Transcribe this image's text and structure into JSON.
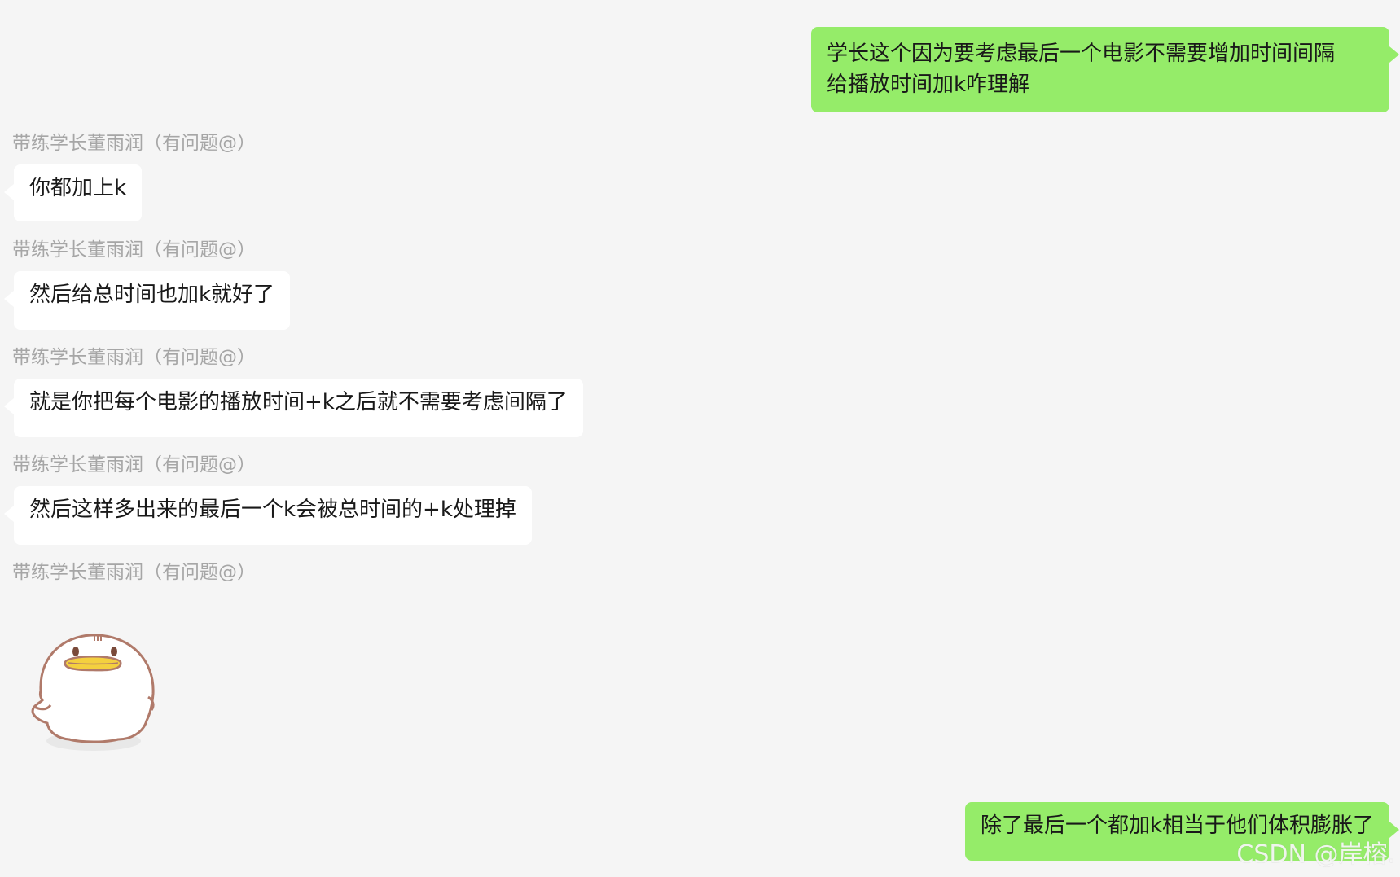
{
  "messages": [
    {
      "text": "学长这个因为要考虑最后一个电影不需要增加时间间隔\n给播放时间加k咋理解"
    },
    {
      "sender": "带练学长董雨润（有问题@）",
      "text": "你都加上k"
    },
    {
      "sender": "带练学长董雨润（有问题@）",
      "text": "然后给总时间也加k就好了"
    },
    {
      "sender": "带练学长董雨润（有问题@）",
      "text": "就是你把每个电影的播放时间+k之后就不需要考虑间隔了"
    },
    {
      "sender": "带练学长董雨润（有问题@）",
      "text": "然后这样多出来的最后一个k会被总时间的+k处理掉"
    },
    {
      "sender": "带练学长董雨润（有问题@）",
      "sticker": "duck-sticker"
    },
    {
      "text": "除了最后一个都加k相当于他们体积膨胀了"
    }
  ],
  "watermark": "CSDN @岸榕.",
  "colors": {
    "background": "#f5f5f5",
    "me_bubble": "#95ec69",
    "other_bubble": "#ffffff",
    "sender_text": "#a6a6a6"
  }
}
